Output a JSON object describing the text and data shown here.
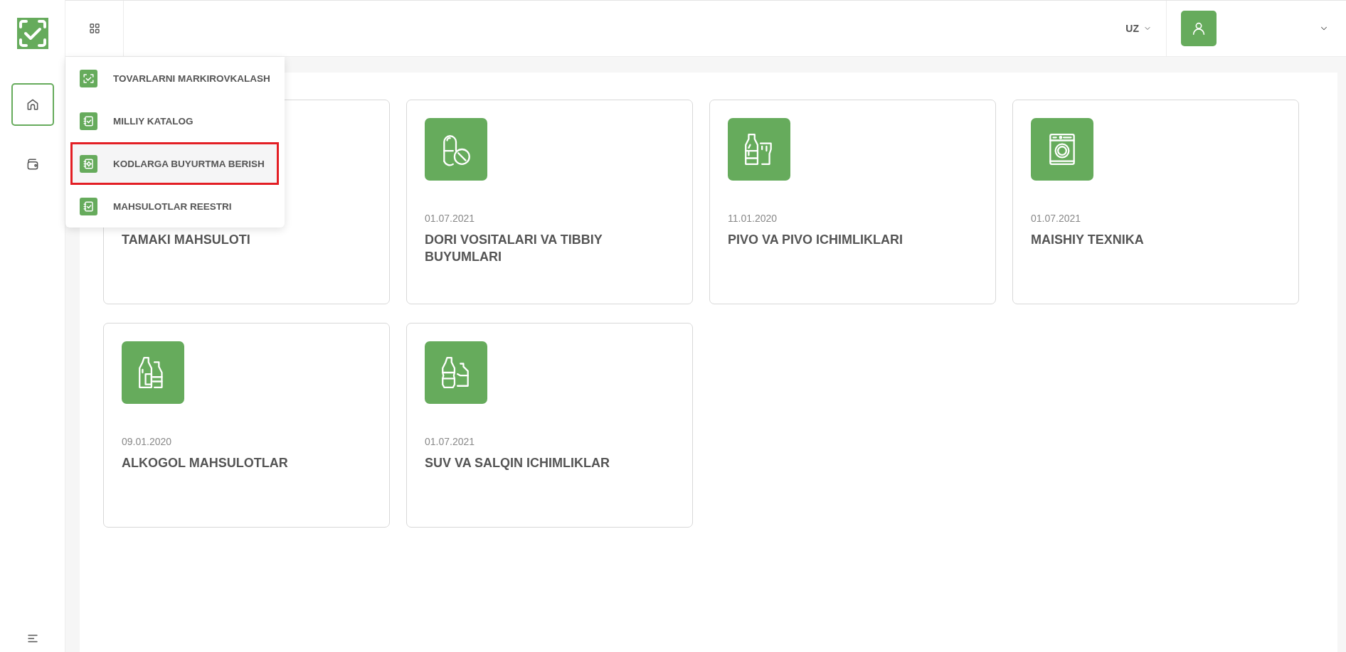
{
  "topbar": {
    "language": "UZ"
  },
  "sidebar": {
    "items": [
      {
        "kind": "home",
        "selected": true
      },
      {
        "kind": "wallet",
        "selected": false
      }
    ]
  },
  "apps_menu": {
    "items": [
      {
        "label": "TOVARLARNI MARKIROVKALASH",
        "kind": "scan",
        "selected": false
      },
      {
        "label": "MILLIY KATALOG",
        "kind": "notebook",
        "selected": false
      },
      {
        "label": "KODLARGA BUYURTMA BERISH",
        "kind": "notebook-gear",
        "selected": true
      },
      {
        "label": "MAHSULOTLAR REESTRI",
        "kind": "notebook",
        "selected": false
      }
    ]
  },
  "cards": [
    {
      "title": "TAMAKI MAHSULOTI"
    },
    {
      "kind": "medicine",
      "date": "01.07.2021",
      "title": "DORI VOSITALARI VA TIBBIY BUYUMLARI"
    },
    {
      "kind": "beer",
      "date": "11.01.2020",
      "title": "PIVO VA PIVO ICHIMLIKLARI"
    },
    {
      "kind": "appliance",
      "date": "01.07.2021",
      "title": "MAISHIY TEXNIKA"
    },
    {
      "kind": "alcohol",
      "date": "09.01.2020",
      "title": "ALKOGOL MAHSULOTLAR"
    },
    {
      "kind": "water",
      "date": "01.07.2021",
      "title": "SUV VA SALQIN ICHIMLIKLAR"
    }
  ]
}
